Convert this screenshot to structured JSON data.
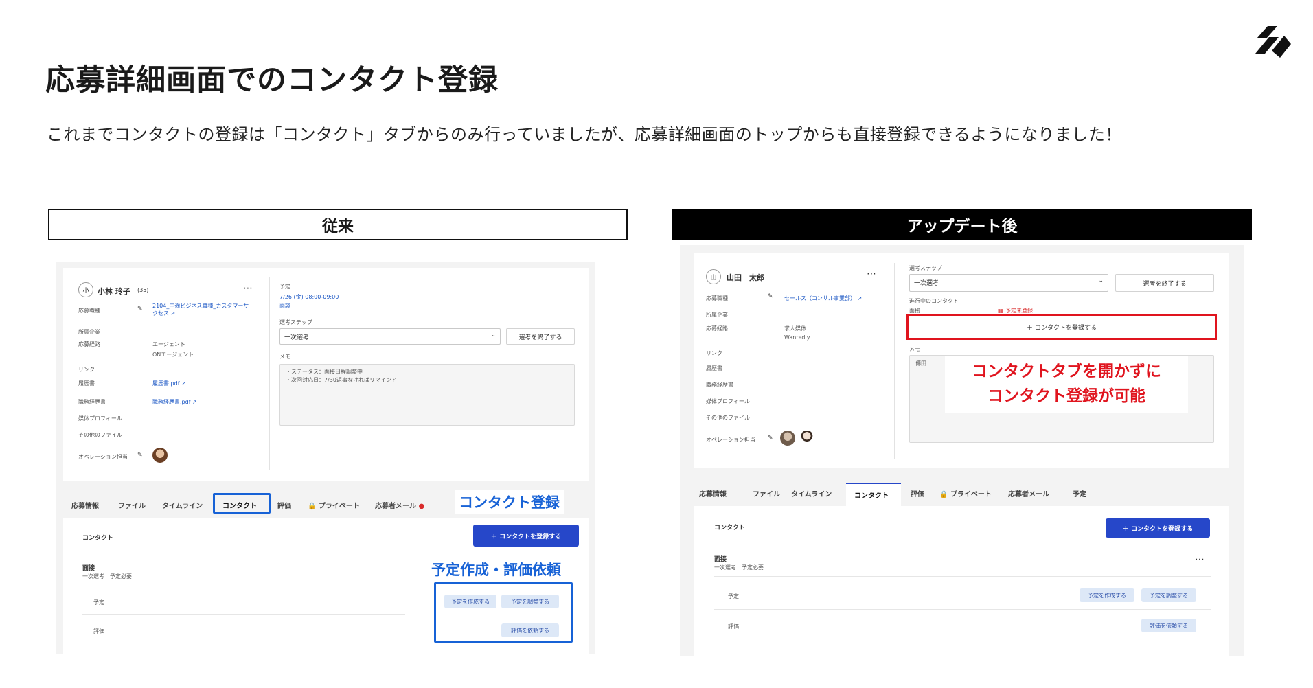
{
  "header": {
    "title": "応募詳細画面でのコンタクト登録",
    "subtitle": "これまでコンタクトの登録は「コンタクト」タブからのみ行っていましたが、応募詳細画面のトップからも直接登録できるようになりました！"
  },
  "before": {
    "heading": "従来",
    "applicant": {
      "initial": "小",
      "name": "小林 玲子",
      "age": "(35)"
    },
    "fields": {
      "job_label": "応募職種",
      "job_value": "2104_中途ビジネス職種_カスタマーサクセス",
      "company_label": "所属企業",
      "route_label": "応募経路",
      "route_value_1": "エージェント",
      "route_value_2": "ONエージェント",
      "link_label": "リンク",
      "resume_label": "履歴書",
      "resume_value": "履歴書.pdf",
      "career_label": "職務経歴書",
      "career_value": "職務経歴書.pdf",
      "media_label": "媒体プロフィール",
      "other_label": "その他のファイル",
      "operator_label": "オペレーション担当"
    },
    "schedule": {
      "label": "予定",
      "datetime": "7/26 (金) 08:00-09:00",
      "type": "面談"
    },
    "step": {
      "label": "選考ステップ",
      "selected": "一次選考",
      "end_button": "選考を終了する"
    },
    "memo": {
      "label": "メモ",
      "line1": "・ステータス：面接日程調整中",
      "line2": "・次回対応日：7/30返事なければリマインド"
    },
    "tabs": [
      "応募情報",
      "ファイル",
      "タイムライン",
      "コンタクト",
      "評価",
      "プライベート",
      "応募者メール"
    ],
    "contact": {
      "title": "コンタクト",
      "register_button": "コンタクトを登録する",
      "item_title": "面接",
      "item_meta": "一次選考　予定必要",
      "row_schedule": "予定",
      "row_eval": "評価",
      "btn_create": "予定を作成する",
      "btn_adjust": "予定を調整する",
      "btn_request": "評価を依頼する"
    },
    "callouts": {
      "contact_register": "コンタクト登録",
      "schedule_eval": "予定作成・評価依頼"
    }
  },
  "after": {
    "heading": "アップデート後",
    "applicant": {
      "initial": "山",
      "name": "山田　太郎"
    },
    "fields": {
      "job_label": "応募職種",
      "job_value": "セールス（コンサル事業部）",
      "company_label": "所属企業",
      "route_label": "応募経路",
      "route_value_1": "求人媒体",
      "route_value_2": "Wantedly",
      "link_label": "リンク",
      "resume_label": "履歴書",
      "career_label": "職務経歴書",
      "media_label": "媒体プロフィール",
      "other_label": "その他のファイル",
      "operator_label": "オペレーション担当"
    },
    "step": {
      "label": "選考ステップ",
      "selected": "一次選考",
      "end_button": "選考を終了する"
    },
    "ongoing": {
      "label": "進行中のコンタクト",
      "item": "面接",
      "status": "予定未登録",
      "add_button": "コンタクトを登録する"
    },
    "memo": {
      "label": "メモ",
      "text": "傳田"
    },
    "callout": {
      "line1": "コンタクトタブを開かずに",
      "line2": "コンタクト登録が可能"
    },
    "tabs": [
      "応募情報",
      "ファイル",
      "タイムライン",
      "コンタクト",
      "評価",
      "プライベート",
      "応募者メール",
      "予定"
    ],
    "contact": {
      "title": "コンタクト",
      "register_button": "コンタクトを登録する",
      "item_title": "面接",
      "item_meta": "一次選考　予定必要",
      "row_schedule": "予定",
      "row_eval": "評価",
      "btn_create": "予定を作成する",
      "btn_adjust": "予定を調整する",
      "btn_request": "評価を依頼する"
    }
  },
  "icons": {
    "logo": "brand-logo-icon",
    "ellipsis": "more-icon",
    "pencil": "edit-icon",
    "external": "external-link-icon",
    "lock": "lock-icon",
    "plus": "plus-icon",
    "chevron": "chevron-down-icon",
    "calendar": "calendar-icon"
  },
  "colors": {
    "accent_blue": "#1762d6",
    "button_blue": "#2647c9",
    "alert_red": "#e0141e"
  }
}
